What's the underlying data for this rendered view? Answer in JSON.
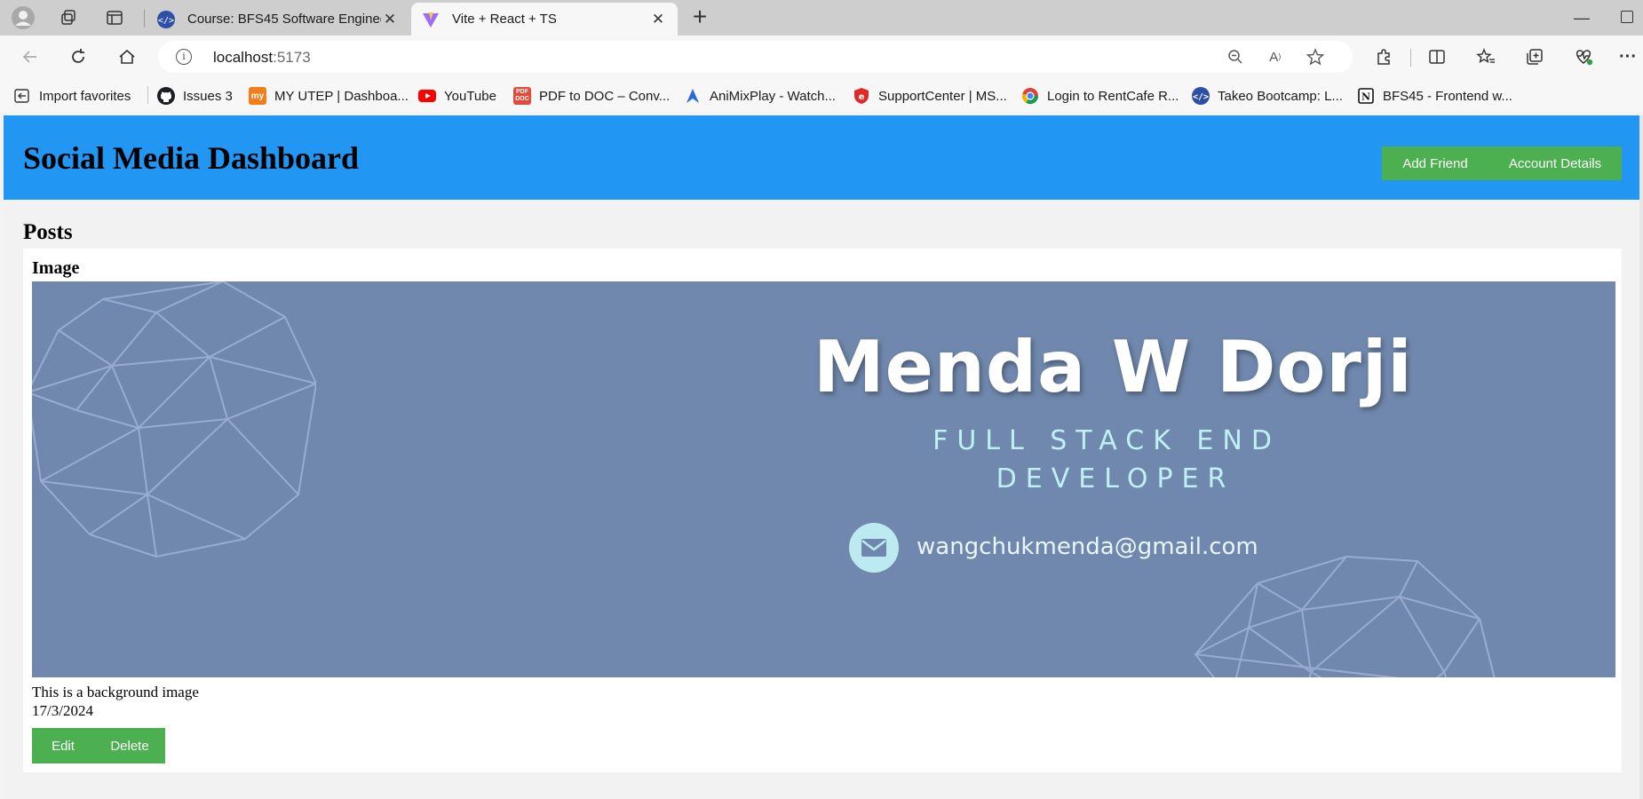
{
  "browser": {
    "tabs": [
      {
        "title": "Course: BFS45 Software Engineer",
        "favicon": "takeo-icon",
        "active": false
      },
      {
        "title": "Vite + React + TS",
        "favicon": "vite-icon",
        "active": true
      }
    ],
    "address": {
      "host": "localhost",
      "port": ":5173"
    },
    "bookmarks": [
      {
        "label": "Import favorites",
        "icon": "import-icon"
      },
      {
        "label": "Issues 3",
        "icon": "github-icon"
      },
      {
        "label": "MY UTEP | Dashboa...",
        "icon": "utep-icon"
      },
      {
        "label": "YouTube",
        "icon": "youtube-icon"
      },
      {
        "label": "PDF to DOC – Conv...",
        "icon": "pdf-icon"
      },
      {
        "label": "AniMixPlay - Watch...",
        "icon": "animix-icon"
      },
      {
        "label": "SupportCenter | MS...",
        "icon": "shield-icon"
      },
      {
        "label": "Login to RentCafe R...",
        "icon": "chrome-icon"
      },
      {
        "label": "Takeo Bootcamp: L...",
        "icon": "takeo-icon"
      },
      {
        "label": "BFS45 - Frontend w...",
        "icon": "notion-icon"
      }
    ]
  },
  "app": {
    "title": "Social Media Dashboard",
    "header_buttons": {
      "add_friend": "Add Friend",
      "account_details": "Account Details"
    },
    "colors": {
      "header": "#2196f3",
      "button": "#4caf50"
    }
  },
  "posts": {
    "heading": "Posts",
    "items": [
      {
        "title": "Image",
        "image": {
          "name": "Menda W Dorji",
          "role_line1": "FULL STACK END",
          "role_line2": "DEVELOPER",
          "email": "wangchukmenda@gmail.com",
          "background": "#7088ad"
        },
        "description": "This is a background image",
        "date": "17/3/2024",
        "edit_label": "Edit",
        "delete_label": "Delete"
      }
    ]
  }
}
